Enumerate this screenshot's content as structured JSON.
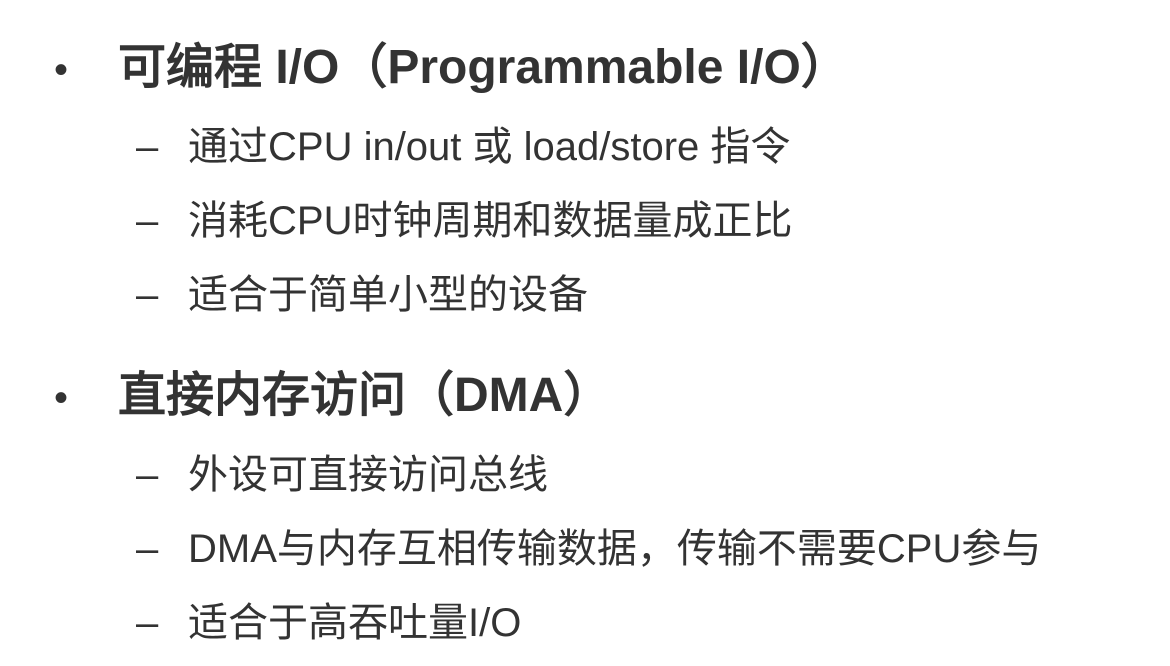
{
  "sections": [
    {
      "bullet": "•",
      "title": "可编程 I/O（Programmable I/O）",
      "items": [
        {
          "dash": "–",
          "text": "通过CPU in/out 或 load/store 指令"
        },
        {
          "dash": "–",
          "text": "消耗CPU时钟周期和数据量成正比"
        },
        {
          "dash": "–",
          "text": "适合于简单小型的设备"
        }
      ]
    },
    {
      "bullet": "•",
      "title": "直接内存访问（DMA）",
      "items": [
        {
          "dash": "–",
          "text": "外设可直接访问总线"
        },
        {
          "dash": "–",
          "text": "DMA与内存互相传输数据，传输不需要CPU参与"
        },
        {
          "dash": "–",
          "text": "适合于高吞吐量I/O"
        }
      ]
    }
  ]
}
